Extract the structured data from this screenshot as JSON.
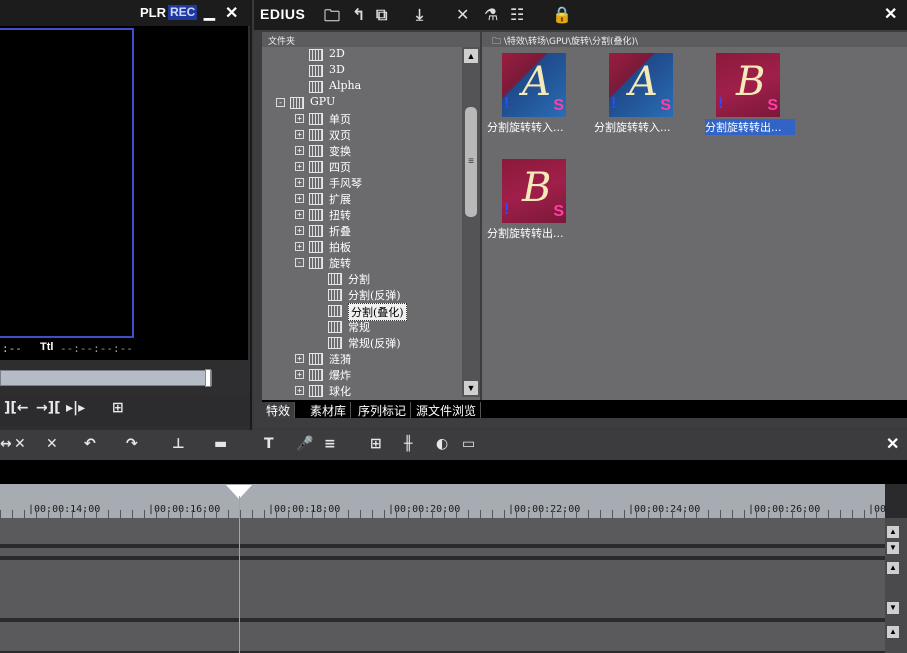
{
  "player": {
    "plr_label": "PLR",
    "rec_label": "REC",
    "min_glyph": "▁",
    "close_glyph": "✕",
    "timecode_left": ":--",
    "ttl_label": "Ttl",
    "ttl_value": "--:--:--:--",
    "tool_glyphs": [
      "][←",
      "→][",
      "▸|▸",
      "⊞"
    ]
  },
  "bin": {
    "title": "EDIUS",
    "close_glyph": "✕",
    "folder_header": "文件夹",
    "path": "\\特效\\转场\\GPU\\旋转\\分割(叠化)\\",
    "tree": [
      {
        "label": "2D",
        "indent": 3,
        "expander": ""
      },
      {
        "label": "3D",
        "indent": 3,
        "expander": ""
      },
      {
        "label": "Alpha",
        "indent": 3,
        "expander": ""
      },
      {
        "label": "GPU",
        "indent": 2,
        "expander": "-",
        "open": true
      },
      {
        "label": "单页",
        "indent": 3,
        "expander": "+"
      },
      {
        "label": "双页",
        "indent": 3,
        "expander": "+"
      },
      {
        "label": "变换",
        "indent": 3,
        "expander": "+"
      },
      {
        "label": "四页",
        "indent": 3,
        "expander": "+"
      },
      {
        "label": "手风琴",
        "indent": 3,
        "expander": "+"
      },
      {
        "label": "扩展",
        "indent": 3,
        "expander": "+"
      },
      {
        "label": "扭转",
        "indent": 3,
        "expander": "+"
      },
      {
        "label": "折叠",
        "indent": 3,
        "expander": "+"
      },
      {
        "label": "拍板",
        "indent": 3,
        "expander": "+"
      },
      {
        "label": "旋转",
        "indent": 3,
        "expander": "-",
        "open": true
      },
      {
        "label": "分割",
        "indent": 4,
        "expander": ""
      },
      {
        "label": "分割(反弹)",
        "indent": 4,
        "expander": ""
      },
      {
        "label": "分割(叠化)",
        "indent": 4,
        "expander": "",
        "selected": true
      },
      {
        "label": "常规",
        "indent": 4,
        "expander": ""
      },
      {
        "label": "常规(反弹)",
        "indent": 4,
        "expander": ""
      },
      {
        "label": "涟漪",
        "indent": 3,
        "expander": "+"
      },
      {
        "label": "爆炸",
        "indent": 3,
        "expander": "+"
      },
      {
        "label": "球化",
        "indent": 3,
        "expander": "+"
      }
    ],
    "clips": [
      {
        "label": "分割旋转转入...",
        "letter": "A",
        "style": "a"
      },
      {
        "label": "分割旋转转入...",
        "letter": "A",
        "style": "a"
      },
      {
        "label": "分割旋转转出...",
        "letter": "B",
        "style": "b",
        "selected": true
      },
      {
        "label": "分割旋转转出...",
        "letter": "B",
        "style": "b"
      }
    ],
    "tabs": [
      "特效",
      "素材库",
      "序列标记",
      "源文件浏览"
    ],
    "active_tab": 0
  },
  "timeline": {
    "close_glyph": "✕",
    "ruler_ticks": [
      "|00:00:14:00",
      "|00:00:16:00",
      "|00:00:18:00",
      "|00:00:20:00",
      "|00:00:22:00",
      "|00:00:24:00",
      "|00:00:26:00",
      "|00"
    ],
    "tool_glyphs": [
      "↔",
      "✕",
      "✕",
      "↶",
      "↷",
      "⊥",
      "▬",
      "T",
      "🎤",
      "≡",
      "⊞",
      "╫",
      "◐",
      "▭"
    ]
  },
  "icons": {
    "bin_tools": [
      "folder-icon",
      "up-icon",
      "copy-icon",
      "import-icon",
      "delete-icon",
      "properties-icon",
      "view-icon",
      "lock-icon"
    ]
  }
}
